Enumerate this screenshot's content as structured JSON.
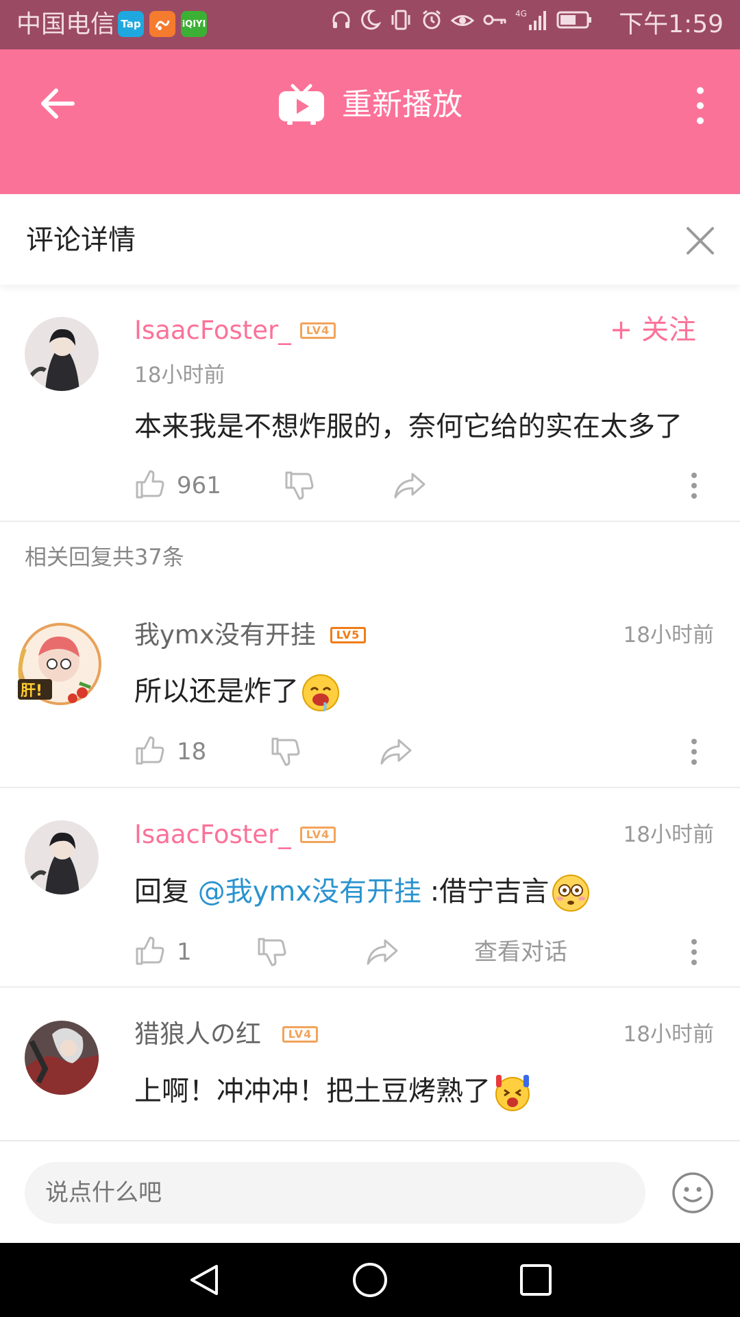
{
  "status_bar": {
    "carrier": "中国电信 ◎",
    "app_icons": [
      "Tap",
      "UC",
      "iQIYI"
    ],
    "time": "下午1:59"
  },
  "app_bar": {
    "title": "重新播放"
  },
  "sheet": {
    "title": "评论详情"
  },
  "main_comment": {
    "username": "IsaacFoster_",
    "level": "LV4",
    "time": "18小时前",
    "follow_label": "+ 关注",
    "content": "本来我是不想炸服的，奈何它给的实在太多了",
    "likes": "961"
  },
  "replies_header": "相关回复共37条",
  "replies": [
    {
      "username": "我ymx没有开挂",
      "level": "LV5",
      "time": "18小时前",
      "content": "所以还是炸了",
      "likes": "18"
    },
    {
      "username": "IsaacFoster_",
      "level": "LV4",
      "time": "18小时前",
      "content_prefix": "回复 ",
      "mention": "@我ymx没有开挂",
      "content_suffix": " :借宁吉言",
      "likes": "1",
      "view_dialog": "查看对话"
    },
    {
      "username": "猎狼人の红",
      "level": "LV4",
      "time": "18小时前",
      "content": "上啊！冲冲冲！把土豆烤熟了"
    }
  ],
  "input": {
    "placeholder": "说点什么吧"
  },
  "colors": {
    "brand_pink": "#fb7299",
    "status_bar": "#9b4a63",
    "mention_blue": "#2a93cf",
    "lv4": "#f3a35a",
    "lv5": "#f07b17"
  }
}
